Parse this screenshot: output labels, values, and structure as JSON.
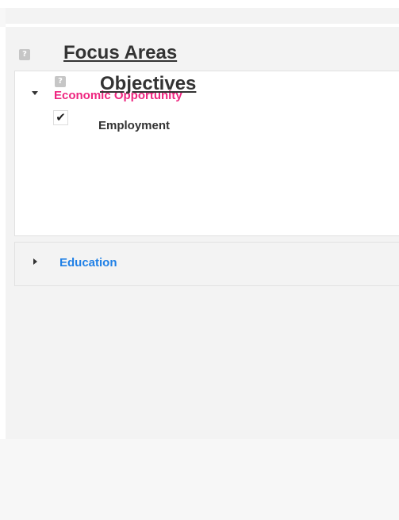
{
  "focus_areas": {
    "title": "Focus Areas",
    "help_icon": "question-icon",
    "help_glyph": "?"
  },
  "sections": [
    {
      "label": "Economic Opportunity",
      "expanded": true,
      "label_color": "#ee2680",
      "objectives": {
        "title": "Objectives",
        "help_icon": "question-icon",
        "help_glyph": "?",
        "items": [
          {
            "label": "Employment",
            "checked": true,
            "check_glyph": "✔"
          }
        ]
      }
    },
    {
      "label": "Education",
      "expanded": false,
      "label_color": "#2080e6"
    }
  ],
  "colors": {
    "background": "#f7f7f7",
    "panel": "#f3f3f3",
    "heading_text": "#333333",
    "help_icon_bg": "#c6c6c6"
  }
}
